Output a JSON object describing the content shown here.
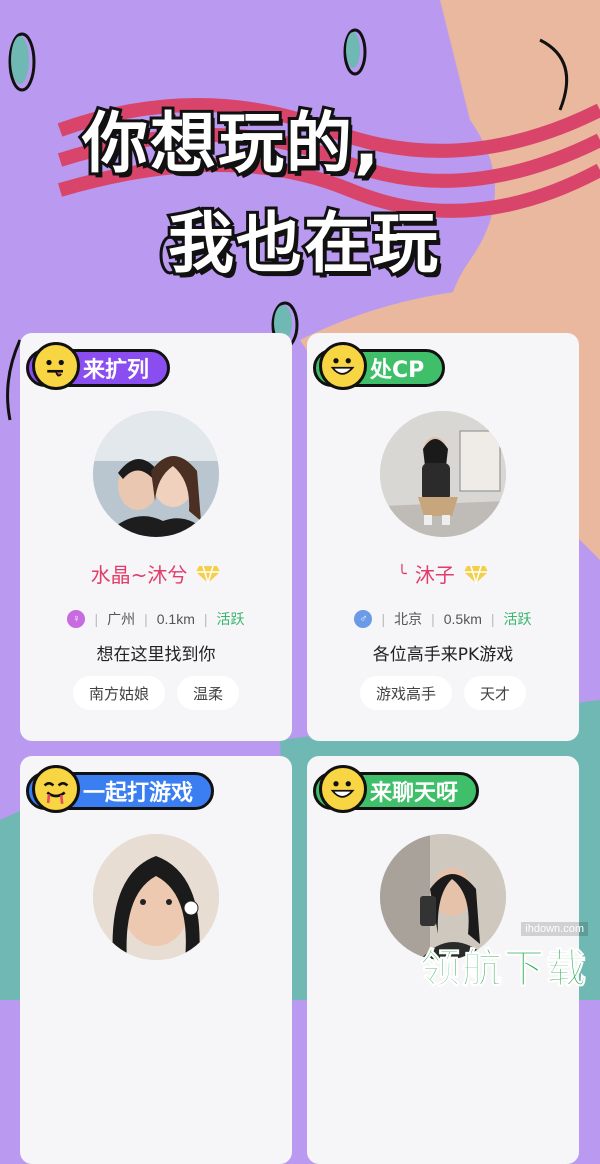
{
  "headline": {
    "line1": "你想玩的,",
    "line2": "我也在玩"
  },
  "cards": [
    {
      "tag": "来扩列",
      "tag_color": "#8a4ef0",
      "emoji": "tongue-face-icon",
      "name": "水晶~沐兮",
      "gender_icon": "female-icon",
      "gender_color": "#c86be0",
      "city": "广州",
      "distance": "0.1km",
      "status": "活跃",
      "bio": "想在这里找到你",
      "tags": [
        "南方姑娘",
        "温柔"
      ]
    },
    {
      "tag": "处CP",
      "tag_color": "#3fbf6a",
      "emoji": "grin-face-icon",
      "name": "沐子",
      "gender_icon": "male-icon",
      "gender_color": "#6b9ae8",
      "city": "北京",
      "distance": "0.5km",
      "status": "活跃",
      "bio": "各位高手来PK游戏",
      "tags": [
        "游戏高手",
        "天才"
      ]
    },
    {
      "tag": "一起打游戏",
      "tag_color": "#3b7ef2",
      "emoji": "drool-face-icon"
    },
    {
      "tag": "来聊天呀",
      "tag_color": "#3fbf6a",
      "emoji": "grin-face-icon"
    }
  ],
  "watermark": {
    "site": "ihdown.com",
    "brand": "领航下载"
  },
  "colors": {
    "background": "#b99af0",
    "name": "#e23c6a",
    "active": "#38b66e"
  }
}
